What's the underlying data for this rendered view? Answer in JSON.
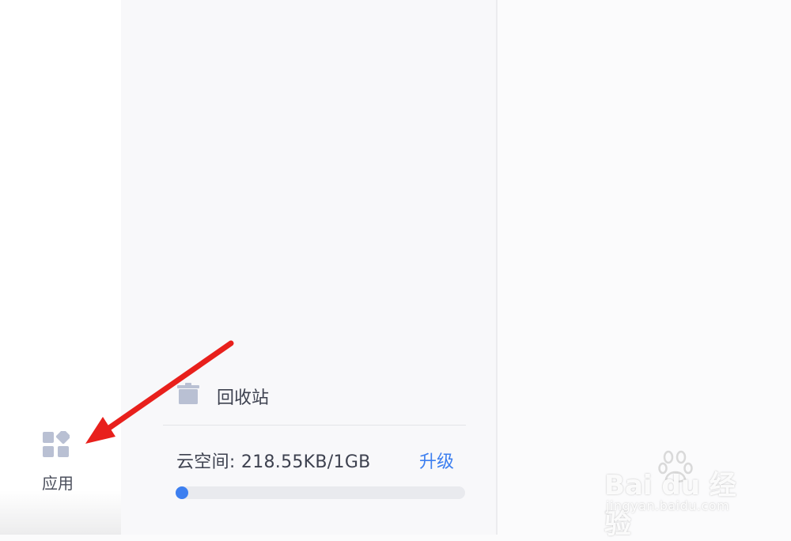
{
  "sidebar": {
    "apps_label": "应用",
    "apps_icon": "apps-grid-icon"
  },
  "panel": {
    "trash": {
      "label": "回收站",
      "icon": "trash-icon"
    },
    "storage": {
      "text": "云空间: 218.55KB/1GB",
      "upgrade_label": "升级",
      "used_fraction": 0.0002
    }
  },
  "watermark": {
    "logo": "Bai du 经验",
    "url": "jingyan.baidu.com"
  },
  "colors": {
    "accent": "#3d7ff0",
    "icon_gray": "#b9c0d3",
    "annotation_arrow": "#e8201c"
  }
}
